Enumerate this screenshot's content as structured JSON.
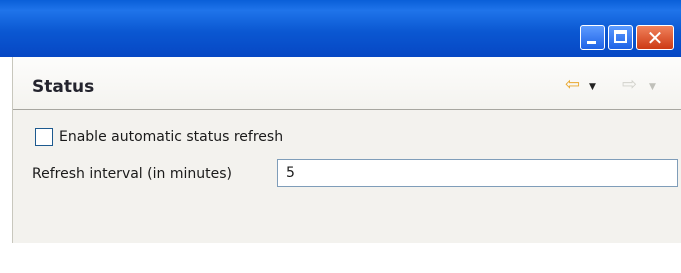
{
  "window": {
    "controls": {
      "minimize_icon": "minimize-icon",
      "maximize_icon": "maximize-icon",
      "close_icon": "close-icon",
      "close_glyph": "✕"
    },
    "colors": {
      "titlebar": "#0b58d2",
      "close_button": "#cd3a14",
      "panel_background": "#f3f2ee"
    }
  },
  "panel": {
    "title": "Status",
    "nav": {
      "back_glyph": "⇦",
      "forward_glyph": "⇨",
      "dropdown_glyph": "▼",
      "back_enabled": true,
      "forward_enabled": false
    },
    "auto_refresh": {
      "label": "Enable automatic status refresh",
      "checked": false
    },
    "refresh_interval": {
      "label": "Refresh interval (in minutes)",
      "value": "5"
    }
  }
}
